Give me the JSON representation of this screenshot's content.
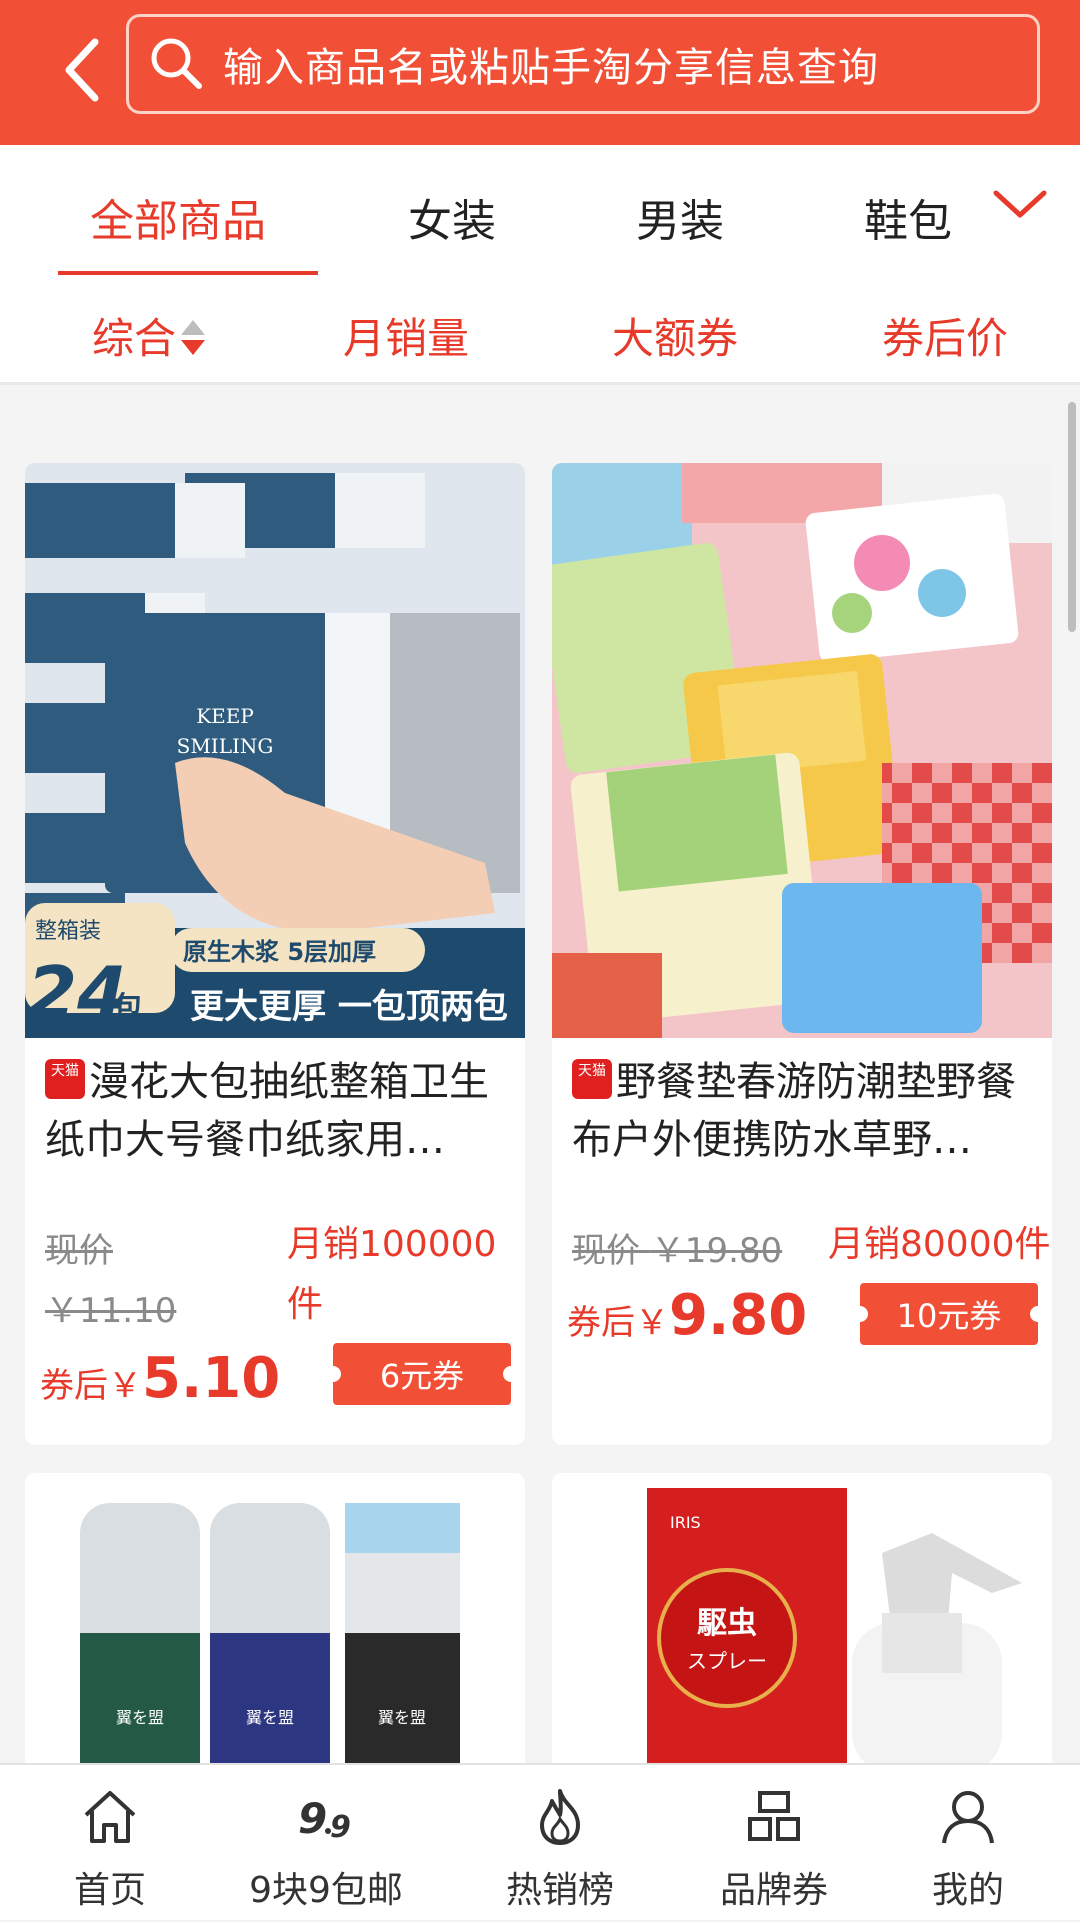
{
  "search": {
    "placeholder": "输入商品名或粘贴手淘分享信息查询"
  },
  "tabs": [
    "全部商品",
    "女装",
    "男装",
    "鞋包"
  ],
  "sort": [
    "综合",
    "月销量",
    "大额券",
    "券后价"
  ],
  "products": [
    {
      "badge": "天猫",
      "title": "漫花大包抽纸整箱卫生纸巾大号餐巾纸家用…",
      "price_label": "现价",
      "original_price": "￥11.10",
      "sales": "月销100000件",
      "after_label": "券后",
      "currency": "￥",
      "after_price": "5.10",
      "coupon": "6元券",
      "image_text": {
        "tag1": "整箱装",
        "tag2": "原生木浆 5层加厚",
        "count": "24",
        "unit": "包",
        "slogan": "更大更厚 一包顶两包",
        "brand": "KEEP SMILING"
      }
    },
    {
      "badge": "天猫",
      "title": "野餐垫春游防潮垫野餐布户外便携防水草野…",
      "price_label": "现价",
      "original_price": "￥19.80",
      "sales": "月销80000件",
      "after_label": "券后",
      "currency": "￥",
      "after_price": "9.80",
      "coupon": "10元券"
    },
    {
      "image_text": {
        "brand": "翼を盟"
      }
    },
    {
      "image_text": {
        "logo": "IRIS",
        "title": "駆虫スプレー"
      }
    }
  ],
  "bottom_nav": [
    {
      "label": "首页",
      "icon": "home-icon"
    },
    {
      "label": "9块9包邮",
      "icon": "nine-nine-icon"
    },
    {
      "label": "热销榜",
      "icon": "flame-icon"
    },
    {
      "label": "品牌券",
      "icon": "brand-icon"
    },
    {
      "label": "我的",
      "icon": "user-icon"
    }
  ],
  "colors": {
    "accent": "#f15037",
    "price_red": "#e83a2a"
  }
}
